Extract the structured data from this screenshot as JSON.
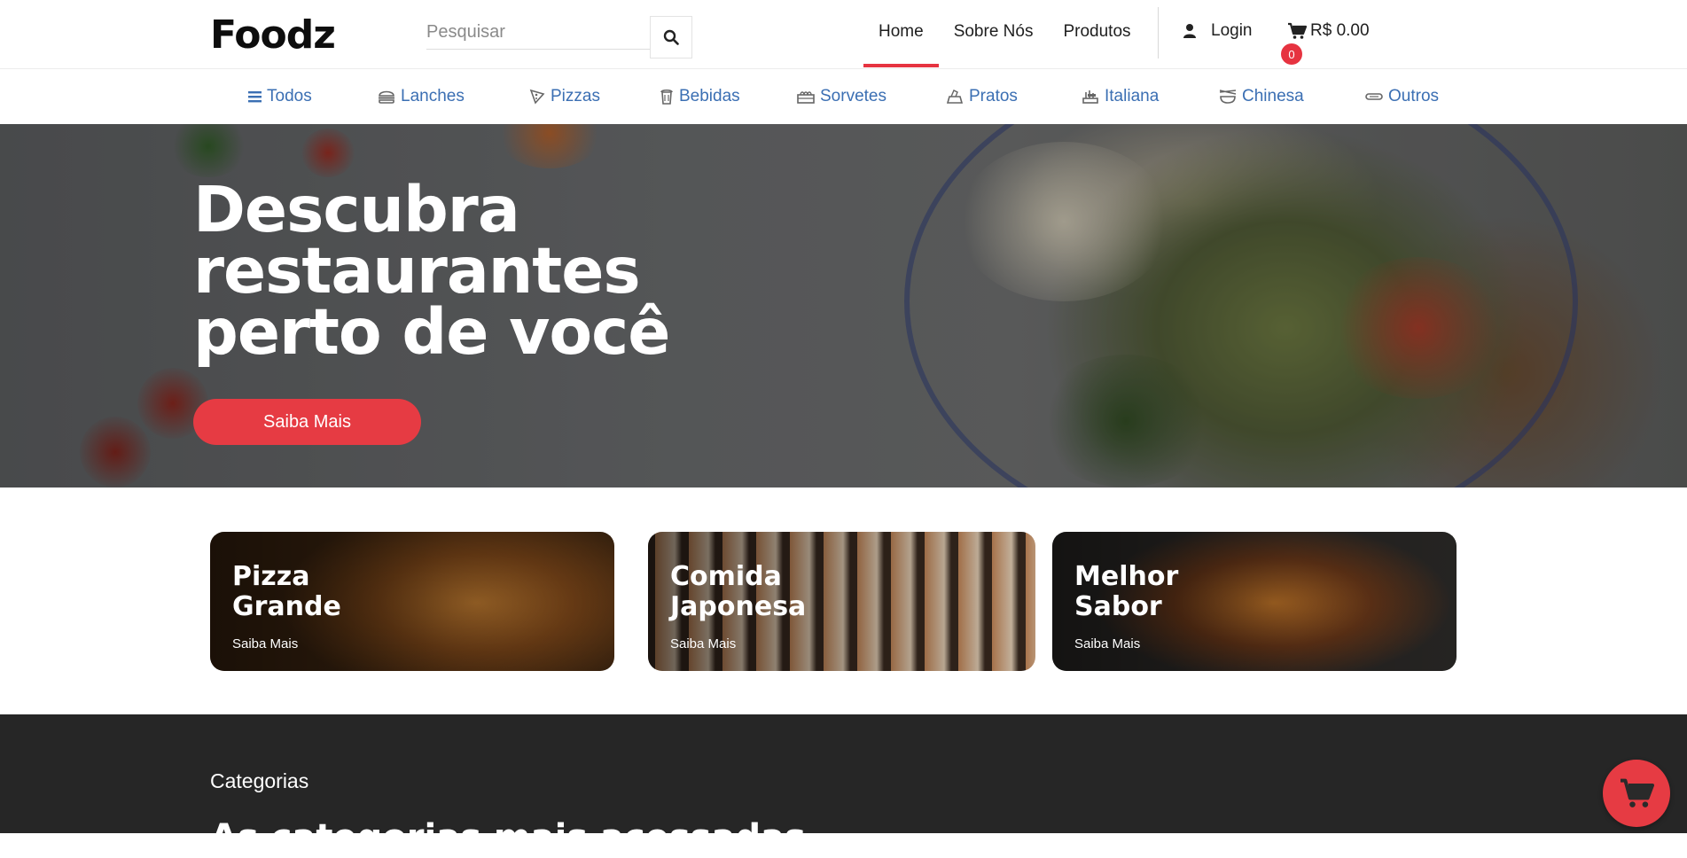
{
  "header": {
    "logo": "Foodz",
    "search": {
      "placeholder": "Pesquisar",
      "value": ""
    },
    "nav": [
      {
        "label": "Home",
        "active": true
      },
      {
        "label": "Sobre Nós",
        "active": false
      },
      {
        "label": "Produtos",
        "active": false
      }
    ],
    "login_label": "Login",
    "cart_total": "R$ 0.00",
    "cart_count": "0"
  },
  "categories": [
    {
      "label": "Todos",
      "icon": "list-icon"
    },
    {
      "label": "Lanches",
      "icon": "burger-icon"
    },
    {
      "label": "Pizzas",
      "icon": "pizza-slice-icon"
    },
    {
      "label": "Bebidas",
      "icon": "drink-icon"
    },
    {
      "label": "Sorvetes",
      "icon": "ice-cream-icon"
    },
    {
      "label": "Pratos",
      "icon": "plate-icon"
    },
    {
      "label": "Italiana",
      "icon": "italian-food-icon"
    },
    {
      "label": "Chinesa",
      "icon": "chinese-food-icon"
    },
    {
      "label": "Outros",
      "icon": "more-food-icon"
    }
  ],
  "hero": {
    "title_lines": [
      "Descubra",
      "restaurantes",
      "perto de você"
    ],
    "button_label": "Saiba Mais"
  },
  "promo_cards": [
    {
      "title_lines": [
        "Pizza",
        "Grande"
      ],
      "link": "Saiba Mais"
    },
    {
      "title_lines": [
        "Comida",
        "Japonesa"
      ],
      "link": "Saiba Mais"
    },
    {
      "title_lines": [
        "Melhor",
        "Sabor"
      ],
      "link": "Saiba Mais"
    }
  ],
  "categories_section": {
    "label": "Categorias",
    "heading": "As categorias mais acessadas"
  },
  "colors": {
    "accent": "#e63340",
    "link_blue": "#3b6fb3",
    "dark_bg": "#262626"
  }
}
